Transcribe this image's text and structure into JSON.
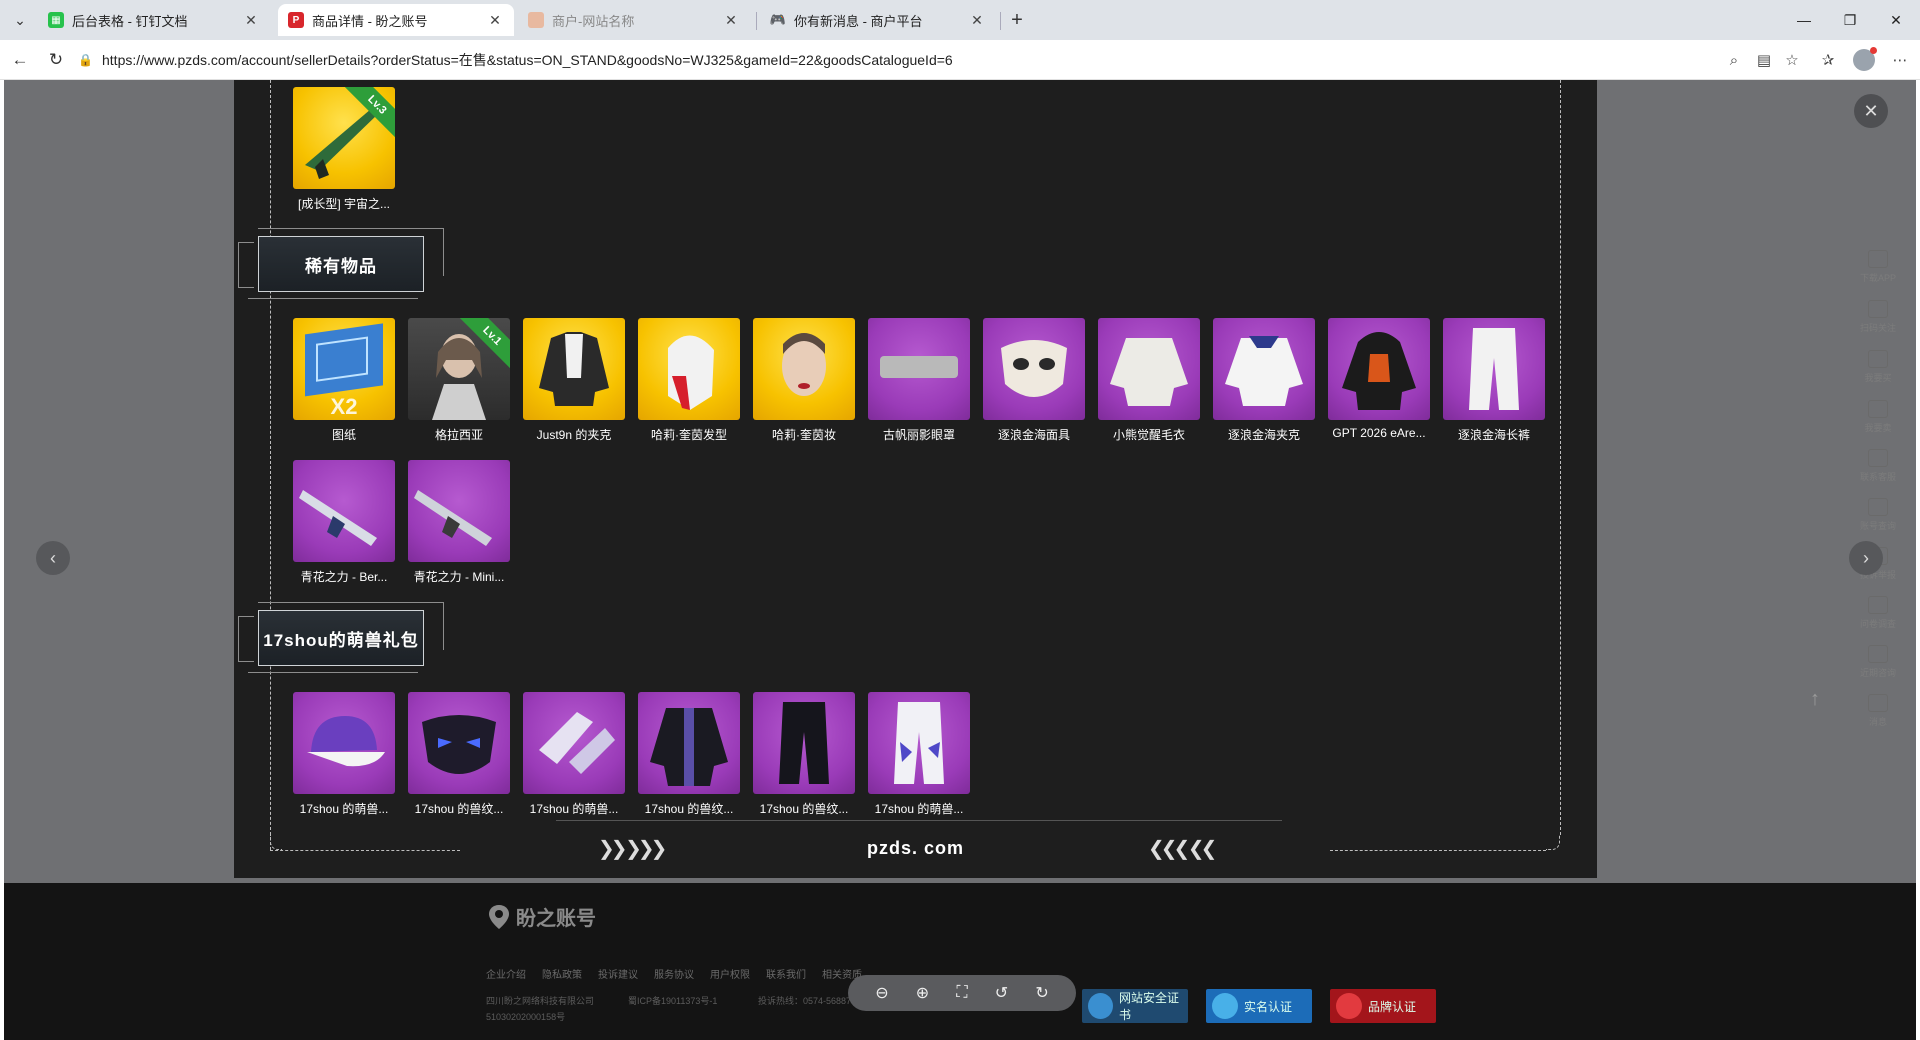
{
  "browser": {
    "tabs": [
      {
        "label": "后台表格 - 钉钉文档",
        "favicon": "dingtalk-doc-icon",
        "active": false
      },
      {
        "label": "商品详情 - 盼之账号",
        "favicon": "pzds-icon",
        "active": true
      },
      {
        "label": "商户-网站名称",
        "favicon": "page-icon",
        "active": false
      },
      {
        "label": "你有新消息 - 商户平台",
        "favicon": "gamepad-icon",
        "active": false
      }
    ],
    "url": "https://www.pzds.com/account/sellerDetails?orderStatus=在售&status=ON_STAND&goodsNo=WJ325&gameId=22&goodsCatalogueId=6"
  },
  "viewer": {
    "top_item": {
      "name": "[成长型] 宇宙之...",
      "badge": "Lv.3"
    },
    "sections": [
      {
        "title": "稀有物品",
        "items": [
          {
            "name": "图纸",
            "qty": "X2"
          },
          {
            "name": "格拉西亚",
            "badge": "Lv.1"
          },
          {
            "name": "Just9n 的夹克"
          },
          {
            "name": "哈莉·奎茵发型"
          },
          {
            "name": "哈莉·奎茵妆"
          },
          {
            "name": "古帆丽影眼罩"
          },
          {
            "name": "逐浪金海面具"
          },
          {
            "name": "小熊觉醒毛衣"
          },
          {
            "name": "逐浪金海夹克"
          },
          {
            "name": "GPT 2026 eAre..."
          },
          {
            "name": "逐浪金海长裤"
          },
          {
            "name": "青花之力 - Ber..."
          },
          {
            "name": "青花之力 - Mini..."
          }
        ]
      },
      {
        "title": "17shou的萌兽礼包",
        "items": [
          {
            "name": "17shou 的萌兽..."
          },
          {
            "name": "17shou 的兽纹..."
          },
          {
            "name": "17shou 的萌兽..."
          },
          {
            "name": "17shou 的兽纹..."
          },
          {
            "name": "17shou 的兽纹..."
          },
          {
            "name": "17shou 的萌兽..."
          }
        ]
      }
    ],
    "brand_text": "pzds. com"
  },
  "footer": {
    "logo": "盼之账号",
    "links": [
      "企业介绍",
      "隐私政策",
      "投诉建议",
      "服务协议",
      "用户权限",
      "联系我们",
      "相关资质"
    ],
    "company": "四川盼之网络科技有限公司",
    "icp": "蜀ICP备19011373号-1",
    "hotline": "投诉热线：0574-56887",
    "police": "51030202000158号",
    "badges": [
      "网站安全证书",
      "实名认证",
      "品牌认证"
    ]
  },
  "sidebar": [
    "下载APP",
    "扫码关注",
    "我要买",
    "我要卖",
    "联系客服",
    "账号查询",
    "投诉举报",
    "问卷调查",
    "近期咨询",
    "消息"
  ]
}
